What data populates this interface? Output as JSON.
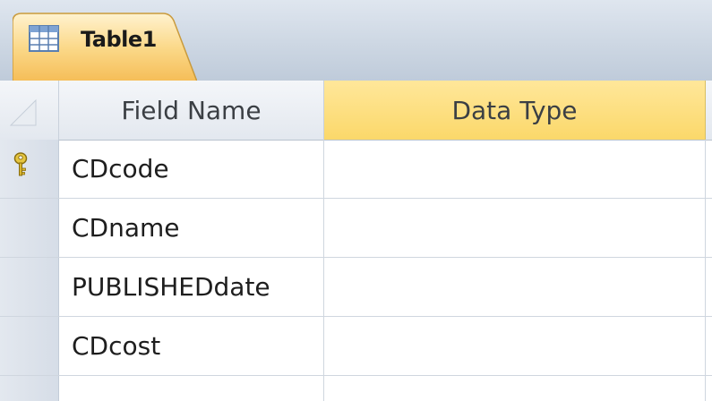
{
  "tab": {
    "label": "Table1",
    "icon": "table-icon"
  },
  "columns": {
    "field_name": "Field Name",
    "data_type": "Data Type"
  },
  "rows": [
    {
      "field_name": "CDcode",
      "data_type": "",
      "primary_key": true
    },
    {
      "field_name": "CDname",
      "data_type": "",
      "primary_key": false
    },
    {
      "field_name": "PUBLISHEDdate",
      "data_type": "",
      "primary_key": false
    },
    {
      "field_name": "CDcost",
      "data_type": "",
      "primary_key": false
    },
    {
      "field_name": "",
      "data_type": "",
      "primary_key": false
    }
  ],
  "colors": {
    "tab_orange": "#f8c66a",
    "header_highlight": "#fbd86a",
    "key_icon": "#c9a824"
  }
}
